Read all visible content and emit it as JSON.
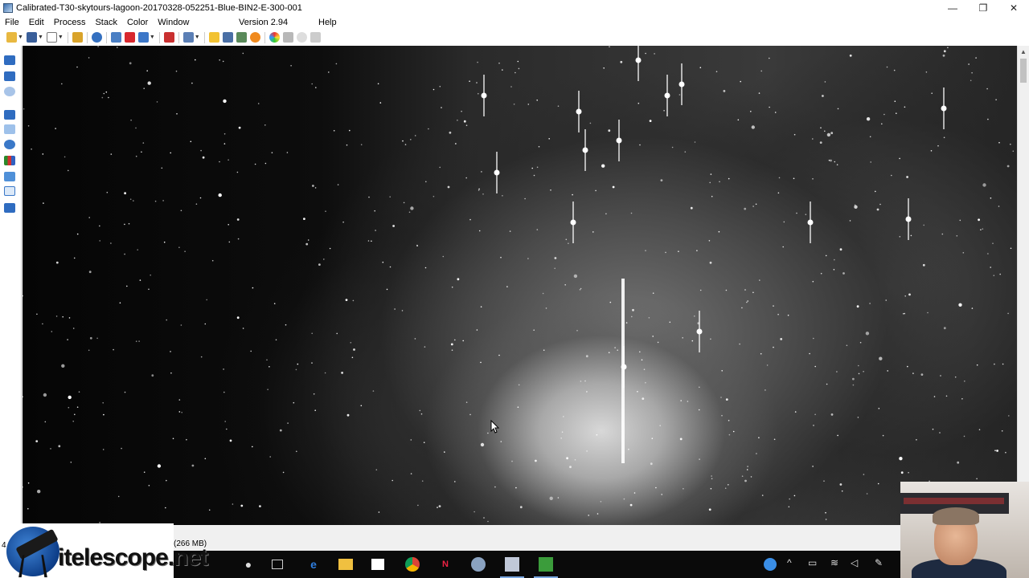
{
  "window": {
    "title": "Calibrated-T30-skytours-lagoon-20170328-052251-Blue-BIN2-E-300-001",
    "controls": {
      "minimize": "—",
      "restore": "❐",
      "close": "✕"
    }
  },
  "menu": {
    "items": [
      "File",
      "Edit",
      "Process",
      "Stack",
      "Color",
      "Window"
    ],
    "version": "Version 2.94",
    "help": "Help"
  },
  "status": {
    "memory": "(266 MB)",
    "left_char": "4"
  },
  "logo": {
    "text": "itelescope.net"
  },
  "colors": {
    "accent": "#3a78c8",
    "taskbar": "#0a0a0a",
    "image_bg": "#000000"
  },
  "icons": {
    "toolbar": [
      "open-folder-icon",
      "save-icon",
      "new-document-icon",
      "key-icon",
      "info-icon",
      "camera-icon",
      "star-icon",
      "refresh-icon",
      "minus-icon",
      "sigma-icon",
      "flag-icon",
      "wrench-icon",
      "calculator-icon",
      "flame-icon",
      "color-wheel-icon",
      "gray-square-icon",
      "circle-icon",
      "filter-icon"
    ],
    "left": [
      "arrow-left-icon",
      "arrow-right-icon",
      "zoom-fit-icon",
      "double-arrow-icon",
      "pin-icon",
      "magnifier-icon",
      "histogram-icon",
      "bucket-icon",
      "select-icon",
      "monitor-icon"
    ],
    "taskbar": [
      "microphone-icon",
      "task-view-icon",
      "edge-icon",
      "file-explorer-icon",
      "store-icon",
      "chrome-icon",
      "ndi-icon",
      "astro-icon",
      "maxim-icon",
      "green-app-icon"
    ],
    "tray": [
      "help-icon",
      "chevron-up-icon",
      "battery-icon",
      "wifi-icon",
      "volume-icon",
      "pen-icon"
    ]
  }
}
